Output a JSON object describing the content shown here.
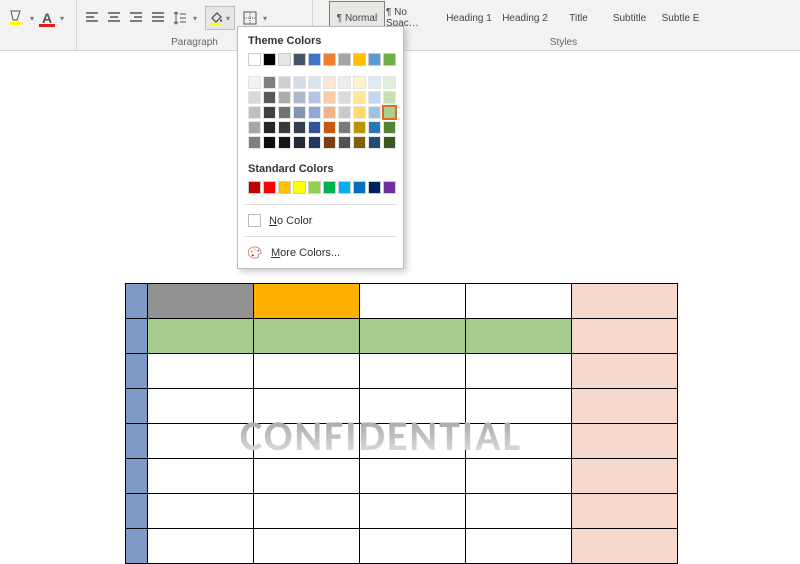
{
  "ribbon": {
    "paragraph_label": "Paragraph",
    "styles_label": "Styles",
    "styles": [
      {
        "label": "¶ Normal",
        "selected": true
      },
      {
        "label": "¶ No Spac…",
        "selected": false
      },
      {
        "label": "Heading 1",
        "selected": false
      },
      {
        "label": "Heading 2",
        "selected": false
      },
      {
        "label": "Title",
        "selected": false
      },
      {
        "label": "Subtitle",
        "selected": false
      },
      {
        "label": "Subtle E",
        "selected": false
      }
    ],
    "highlight_color": "#ffff00",
    "font_color": "#e31b1b"
  },
  "shading_dropdown": {
    "theme_title": "Theme Colors",
    "standard_title": "Standard Colors",
    "no_color_label": "No Color",
    "more_colors_label": "More Colors...",
    "theme_row": [
      "#ffffff",
      "#000000",
      "#e7e6e6",
      "#44546a",
      "#4472c4",
      "#ed7d31",
      "#a5a5a5",
      "#ffc000",
      "#5b9bd5",
      "#70ad47"
    ],
    "theme_tints": [
      [
        "#f2f2f2",
        "#7f7f7f",
        "#d0cece",
        "#d6dce5",
        "#d9e1f2",
        "#fbe5d6",
        "#ededed",
        "#fff2cc",
        "#deeaf6",
        "#e2efda"
      ],
      [
        "#d9d9d9",
        "#595959",
        "#aeaaaa",
        "#adb9ca",
        "#b4c6e7",
        "#f8cbad",
        "#dbdbdb",
        "#ffe699",
        "#bdd7ee",
        "#c6e0b4"
      ],
      [
        "#bfbfbf",
        "#404040",
        "#757171",
        "#8497b0",
        "#8eaadb",
        "#f4b183",
        "#c9c9c9",
        "#ffd966",
        "#9dc3e6",
        "#a9d18e"
      ],
      [
        "#a6a6a6",
        "#262626",
        "#3b3838",
        "#333f50",
        "#2f5597",
        "#c55a11",
        "#7b7b7b",
        "#bf9000",
        "#2e75b6",
        "#548235"
      ],
      [
        "#808080",
        "#0d0d0d",
        "#161616",
        "#222a35",
        "#1f3864",
        "#843c0c",
        "#525252",
        "#806000",
        "#1f4e79",
        "#385723"
      ]
    ],
    "standard_row": [
      "#c00000",
      "#ff0000",
      "#ffc000",
      "#ffff00",
      "#92d050",
      "#00b050",
      "#00b0f0",
      "#0070c0",
      "#002060",
      "#7030a0"
    ],
    "selected_theme": [
      2,
      9
    ]
  },
  "document": {
    "watermark": "CONFIDENTIAL",
    "table": {
      "stub_color": "#7e9bc8",
      "col5_color": "#f6d9cd",
      "rows": [
        {
          "cells": [
            "#919191",
            "#ffb000",
            "#ffffff",
            "#ffffff"
          ]
        },
        {
          "cells": [
            "#a6cb8e",
            "#a6cb8e",
            "#a6cb8e",
            "#a6cb8e"
          ]
        },
        {
          "cells": [
            "#ffffff",
            "#ffffff",
            "#ffffff",
            "#ffffff"
          ]
        },
        {
          "cells": [
            "#ffffff",
            "#ffffff",
            "#ffffff",
            "#ffffff"
          ]
        },
        {
          "cells": [
            "#ffffff",
            "#ffffff",
            "#ffffff",
            "#ffffff"
          ]
        },
        {
          "cells": [
            "#ffffff",
            "#ffffff",
            "#ffffff",
            "#ffffff"
          ]
        },
        {
          "cells": [
            "#ffffff",
            "#ffffff",
            "#ffffff",
            "#ffffff"
          ]
        },
        {
          "cells": [
            "#ffffff",
            "#ffffff",
            "#ffffff",
            "#ffffff"
          ]
        }
      ]
    }
  }
}
